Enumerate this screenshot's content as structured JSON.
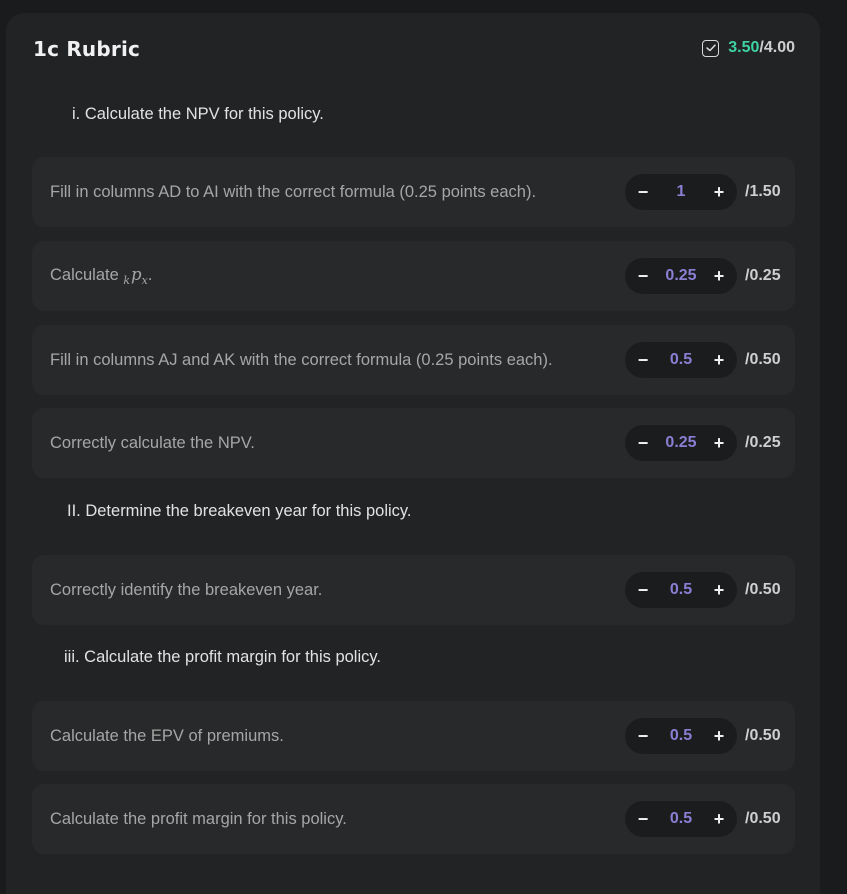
{
  "rubric": {
    "title": "1c Rubric",
    "earned": "3.50",
    "possible": "/4.00"
  },
  "sections": [
    {
      "heading": "i. Calculate the NPV for this policy.",
      "items": [
        {
          "label": "Fill in columns AD to AI with the correct formula (0.25 points each).",
          "value": "1",
          "max": "/1.50"
        },
        {
          "label_prefix": "Calculate ",
          "math_pre": "k",
          "math_main": "p",
          "math_post": "x",
          "label_suffix": ".",
          "value": "0.25",
          "max": "/0.25"
        },
        {
          "label": "Fill in columns AJ and AK with the correct formula (0.25 points each).",
          "value": "0.5",
          "max": "/0.50"
        },
        {
          "label": "Correctly calculate the NPV.",
          "value": "0.25",
          "max": "/0.25"
        }
      ]
    },
    {
      "heading": "II. Determine the breakeven year for this policy.",
      "items": [
        {
          "label": "Correctly identify the breakeven year.",
          "value": "0.5",
          "max": "/0.50"
        }
      ]
    },
    {
      "heading": "iii. Calculate the profit margin for this policy.",
      "items": [
        {
          "label": "Calculate the EPV of premiums.",
          "value": "0.5",
          "max": "/0.50"
        },
        {
          "label": "Calculate the profit margin for this policy.",
          "value": "0.5",
          "max": "/0.50"
        }
      ]
    }
  ],
  "controls": {
    "decrement": "−",
    "increment": "+"
  },
  "colors": {
    "earned_accent": "#3fd2a2",
    "value_accent": "#8a7fd4"
  },
  "icons": {
    "score": "checkbox-checked-icon"
  }
}
